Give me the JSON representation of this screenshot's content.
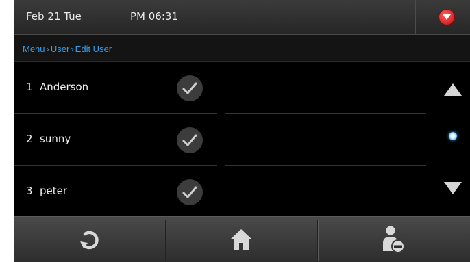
{
  "header": {
    "date": "Feb 21 Tue",
    "time": "PM 06:31",
    "dropdown_icon": "chevron-down-icon",
    "accent_color": "#d91515"
  },
  "breadcrumb": {
    "items": [
      "Menu",
      "User",
      "Edit User"
    ],
    "color": "#3a9be6"
  },
  "users": [
    {
      "index": "1",
      "name": "Anderson",
      "checked": true
    },
    {
      "index": "2",
      "name": "sunny",
      "checked": true
    },
    {
      "index": "3",
      "name": "peter",
      "checked": true
    }
  ],
  "scroll": {
    "up_icon": "triangle-up-icon",
    "down_icon": "triangle-down-icon",
    "indicator_color": "#4fb7ff"
  },
  "footer": {
    "buttons": [
      {
        "icon": "refresh-icon"
      },
      {
        "icon": "home-icon"
      },
      {
        "icon": "user-remove-icon"
      }
    ]
  }
}
